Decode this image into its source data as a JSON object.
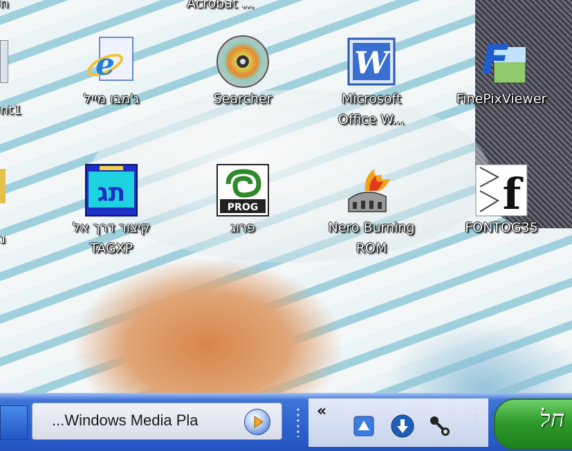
{
  "desktop": {
    "top_label": "Acrobat ...",
    "left_partial_top": "ח",
    "left_partial_label": "nt1",
    "left_partial_label2": "נ",
    "icons": [
      {
        "id": "ie",
        "label": "ג'מבו מייל",
        "icon": "internet-explorer-icon"
      },
      {
        "id": "searcher",
        "label": "Searcher",
        "icon": "cd-disc-icon"
      },
      {
        "id": "word",
        "label": "Microsoft\nOffice W...",
        "icon": "word-icon"
      },
      {
        "id": "finepix",
        "label": "FinePixViewer",
        "icon": "finepix-icon"
      },
      {
        "id": "tag",
        "label": "קיצור דרך אל\nTAGXP",
        "icon": "tag-icon"
      },
      {
        "id": "prog",
        "label": "פרוג",
        "icon": "prog-icon"
      },
      {
        "id": "nero",
        "label": "Nero Burning\nROM",
        "icon": "nero-icon"
      },
      {
        "id": "fontog",
        "label": "FONTOG35",
        "icon": "fontog-icon"
      }
    ]
  },
  "taskbar": {
    "media_task_label": "...Windows Media Pla",
    "chevron": "«",
    "start_label": "חל",
    "tray_icons": [
      "network-sync-icon",
      "download-icon",
      "connection-icon"
    ]
  },
  "colors": {
    "taskbar": "#2f63cf",
    "start": "#2f9c2b",
    "label_text": "#ffffff"
  }
}
